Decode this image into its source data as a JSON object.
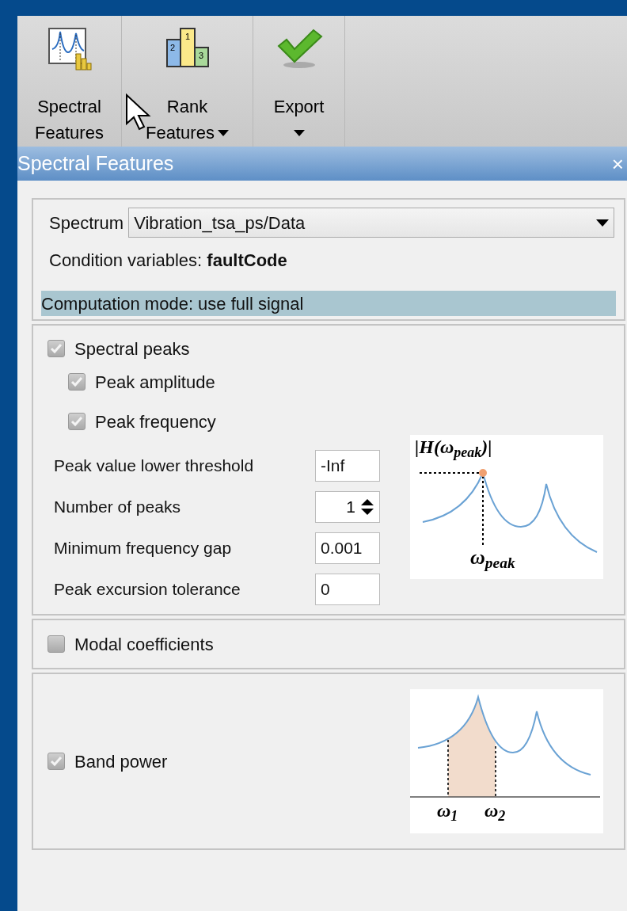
{
  "toolbar": [
    {
      "kind": "spectral",
      "lines": [
        "Spectral",
        "Features"
      ],
      "dropdown": false
    },
    {
      "kind": "rank",
      "lines": [
        "Rank",
        "Features"
      ],
      "dropdown": true,
      "icon_labels": [
        "2",
        "1",
        "3"
      ]
    },
    {
      "kind": "export",
      "lines": [
        "Export"
      ],
      "dropdown": true
    }
  ],
  "panel": {
    "title": "Spectral Features",
    "close": "×"
  },
  "source": {
    "spectrum_label": "Spectrum",
    "spectrum_value": "Vibration_tsa_ps/Data",
    "condition": "Condition variables: **faultCode**",
    "mode": "Computation mode: use full signal"
  },
  "peaks": {
    "label": "Spectral peaks",
    "checked": true,
    "options": [
      {
        "label": "Peak amplitude",
        "checked": true
      },
      {
        "label": "Peak frequency",
        "checked": true
      }
    ],
    "params": [
      {
        "kind": "text",
        "label": "Peak value lower threshold",
        "value": "-Inf"
      },
      {
        "kind": "spinner",
        "label": "Number of peaks",
        "value": "1"
      },
      {
        "kind": "text",
        "label": "Minimum frequency gap",
        "value": "0.001"
      },
      {
        "kind": "text",
        "label": "Peak excursion tolerance",
        "value": "0"
      }
    ],
    "figure": {
      "top_label": "|H(ω$_{peak}$)|",
      "bottom_label": "ω$_{peak}$"
    }
  },
  "modal": {
    "label": "Modal coefficients",
    "checked": false
  },
  "band": {
    "label": "Band power",
    "checked": true,
    "figure": {
      "labels": [
        "ω$_{1}$",
        "ω$_{2}$"
      ]
    }
  }
}
